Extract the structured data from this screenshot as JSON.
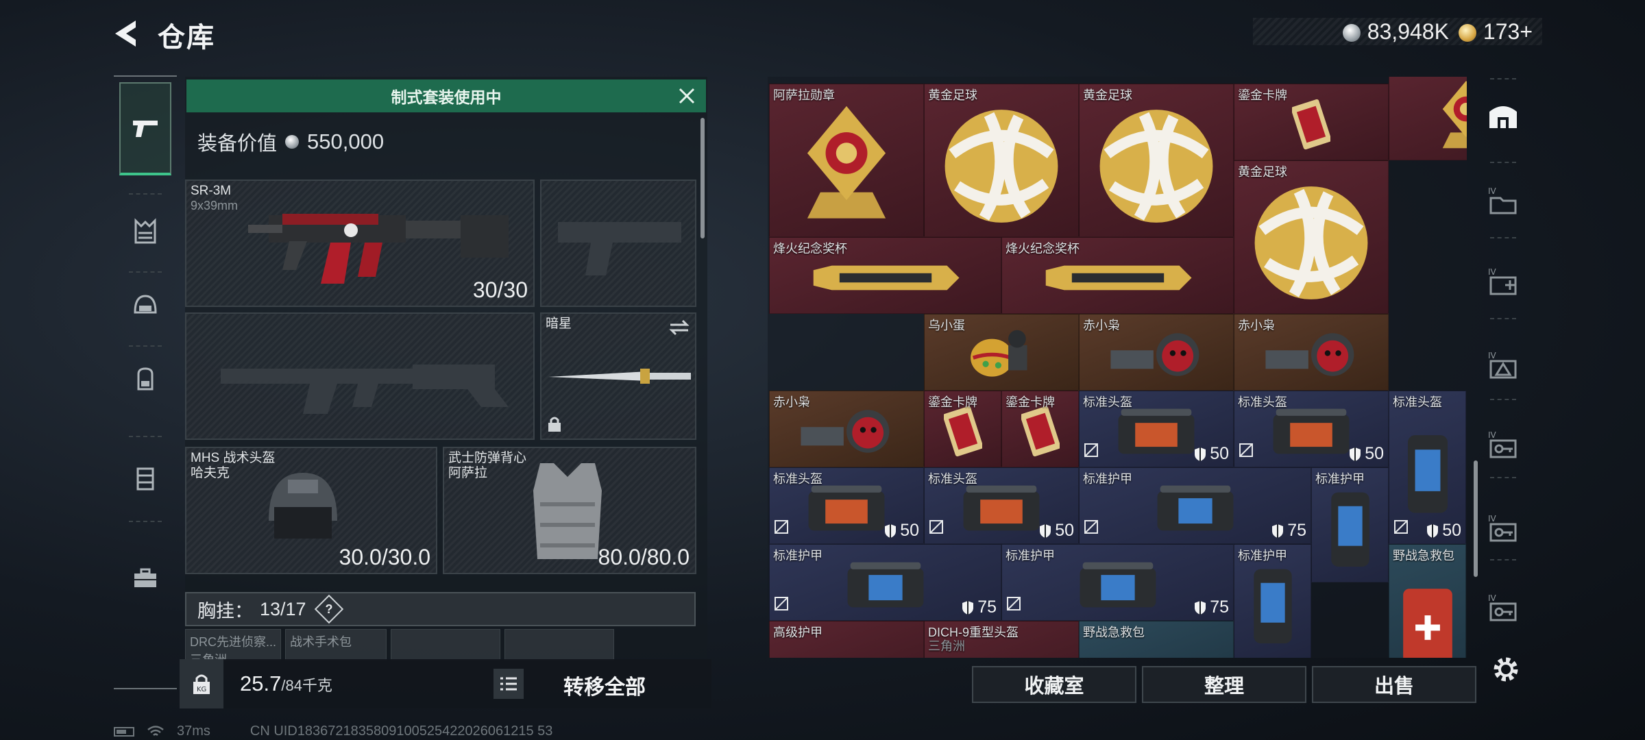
{
  "header": {
    "title": "仓库",
    "currency_silver": "83,948K",
    "currency_gold": "173+"
  },
  "loadout": {
    "banner": "制式套装使用中",
    "value_label": "装备价值",
    "value": "550,000",
    "primary_weapon": {
      "name": "SR-3M",
      "caliber": "9x39mm",
      "ammo": "30/30"
    },
    "melee": {
      "name": "暗星"
    },
    "helmet": {
      "name": "MHS 战术头盔",
      "map": "哈夫克",
      "durability": "30.0/30.0"
    },
    "armor": {
      "name": "武士防弹背心",
      "map": "阿萨拉",
      "durability": "80.0/80.0"
    },
    "chest_rig_label": "胸挂：",
    "chest_rig_count": "13/17",
    "help": "?",
    "chest_slots": [
      {
        "name": "DRC先进侦察...",
        "sub": "三角洲"
      },
      {
        "name": "战术手术包",
        "sub": ""
      },
      {
        "name": "",
        "sub": ""
      }
    ],
    "weight": "25.7",
    "weight_max": "/84千克",
    "transfer_all": "转移全部"
  },
  "storage": {
    "items": [
      {
        "id": "a1",
        "label": "阿萨拉勋章",
        "color": "maroon",
        "art": "medal-gold"
      },
      {
        "id": "a2",
        "label": "黄金足球",
        "color": "maroon",
        "art": "gold-ball"
      },
      {
        "id": "a3",
        "label": "黄金足球",
        "color": "maroon",
        "art": "gold-ball"
      },
      {
        "id": "a4",
        "label": "鎏金卡牌",
        "color": "maroon",
        "art": "gold-card"
      },
      {
        "id": "a5",
        "label": "",
        "color": "maroon",
        "art": "medal-gold"
      },
      {
        "id": "a6",
        "label": "黄金足球",
        "color": "maroon",
        "art": "gold-ball"
      },
      {
        "id": "a7",
        "label": "烽火纪念...",
        "color": "maroon",
        "art": "trophy"
      },
      {
        "id": "a8",
        "label": "烽火纪念奖杯",
        "color": "maroon",
        "art": "trophy-h"
      },
      {
        "id": "a9",
        "label": "烽火纪念奖杯",
        "color": "maroon",
        "art": "trophy-h"
      },
      {
        "id": "b1",
        "label": "乌小蛋",
        "color": "brown",
        "art": "egg"
      },
      {
        "id": "b2",
        "label": "赤小枭",
        "color": "brown",
        "art": "owl"
      },
      {
        "id": "b3",
        "label": "赤小枭",
        "color": "brown",
        "art": "owl"
      },
      {
        "id": "b4",
        "label": "赤小枭",
        "color": "brown",
        "art": "owl"
      },
      {
        "id": "c1",
        "label": "鎏金卡牌",
        "color": "maroon",
        "art": "gold-card"
      },
      {
        "id": "c2",
        "label": "鎏金卡牌",
        "color": "maroon",
        "art": "gold-card"
      },
      {
        "id": "h1",
        "label": "标准头盔",
        "color": "navy",
        "art": "helmet-case",
        "durability": "50"
      },
      {
        "id": "h2",
        "label": "标准头盔",
        "color": "navy",
        "art": "helmet-case",
        "durability": "50"
      },
      {
        "id": "h3",
        "label": "标准头盔",
        "color": "navy",
        "art": "armor-tall",
        "durability": "50"
      },
      {
        "id": "h4",
        "label": "标准头盔",
        "color": "navy",
        "art": "helmet-case",
        "durability": "50"
      },
      {
        "id": "h5",
        "label": "标准头盔",
        "color": "navy",
        "art": "helmet-case",
        "durability": "50"
      },
      {
        "id": "r1",
        "label": "标准护甲",
        "color": "navy",
        "art": "armor-case",
        "durability": "75"
      },
      {
        "id": "r2",
        "label": "标准护甲",
        "color": "navy",
        "art": "armor-tall"
      },
      {
        "id": "r3",
        "label": "标准护甲",
        "color": "navy",
        "art": "armor-case",
        "durability": "75"
      },
      {
        "id": "r4",
        "label": "标准护甲",
        "color": "navy",
        "art": "armor-case",
        "durability": "75"
      },
      {
        "id": "r5",
        "label": "标准护甲",
        "color": "navy",
        "art": "armor-tall"
      },
      {
        "id": "m1",
        "label": "野战急救包",
        "color": "teal",
        "art": "medkit"
      },
      {
        "id": "x1",
        "label": "高级护甲",
        "color": "maroon",
        "art": ""
      },
      {
        "id": "x2",
        "label": "DICH-9重型头盔",
        "sub": "三角洲",
        "color": "maroon",
        "art": ""
      },
      {
        "id": "x3",
        "label": "野战急救包",
        "color": "teal",
        "art": ""
      }
    ]
  },
  "actions": {
    "collection": "收藏室",
    "sort": "整理",
    "sell": "出售"
  },
  "status_bar": {
    "ping": "37ms",
    "uid": "CN UID1836721835809100525422026061215 53"
  },
  "colors": {
    "accent_green": "#1e6b4e",
    "maroon": "#5a2530",
    "navy": "#2f3656",
    "brown": "#5a3b2a",
    "teal": "#2d4a5a"
  }
}
